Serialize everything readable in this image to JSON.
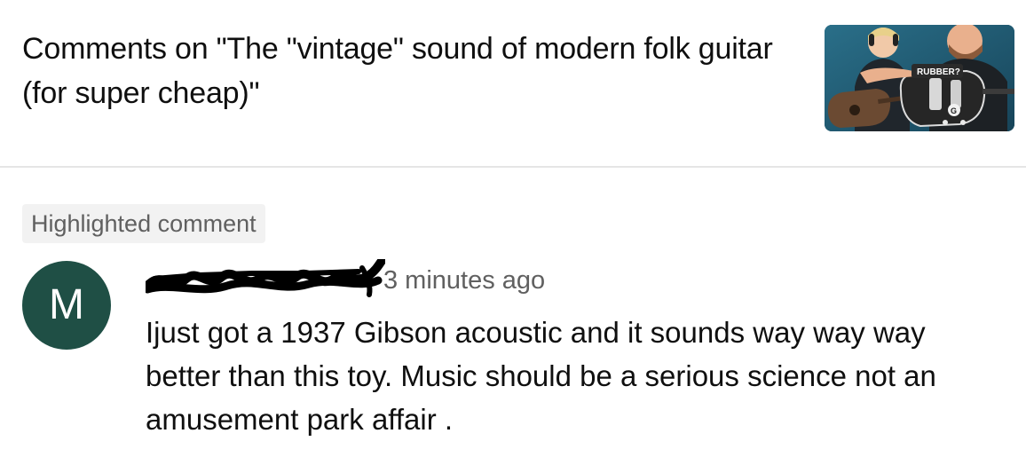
{
  "header": {
    "title": "Comments on \"The \"vintage\" sound of modern folk guitar (for super cheap)\"",
    "thumbnail": {
      "caption": "RUBBER?",
      "logo_letter": "G"
    }
  },
  "comment": {
    "badge": "Highlighted comment",
    "avatar_letter": "M",
    "timestamp": "3 minutes ago",
    "text": "Ijust got a 1937 Gibson acoustic and it sounds way way way better than this toy. Music should be a serious science not an amusement park affair ."
  },
  "colors": {
    "avatar_bg": "#1f4f45",
    "badge_bg": "#f2f2f2",
    "secondary_text": "#606060",
    "primary_text": "#0f0f0f"
  }
}
